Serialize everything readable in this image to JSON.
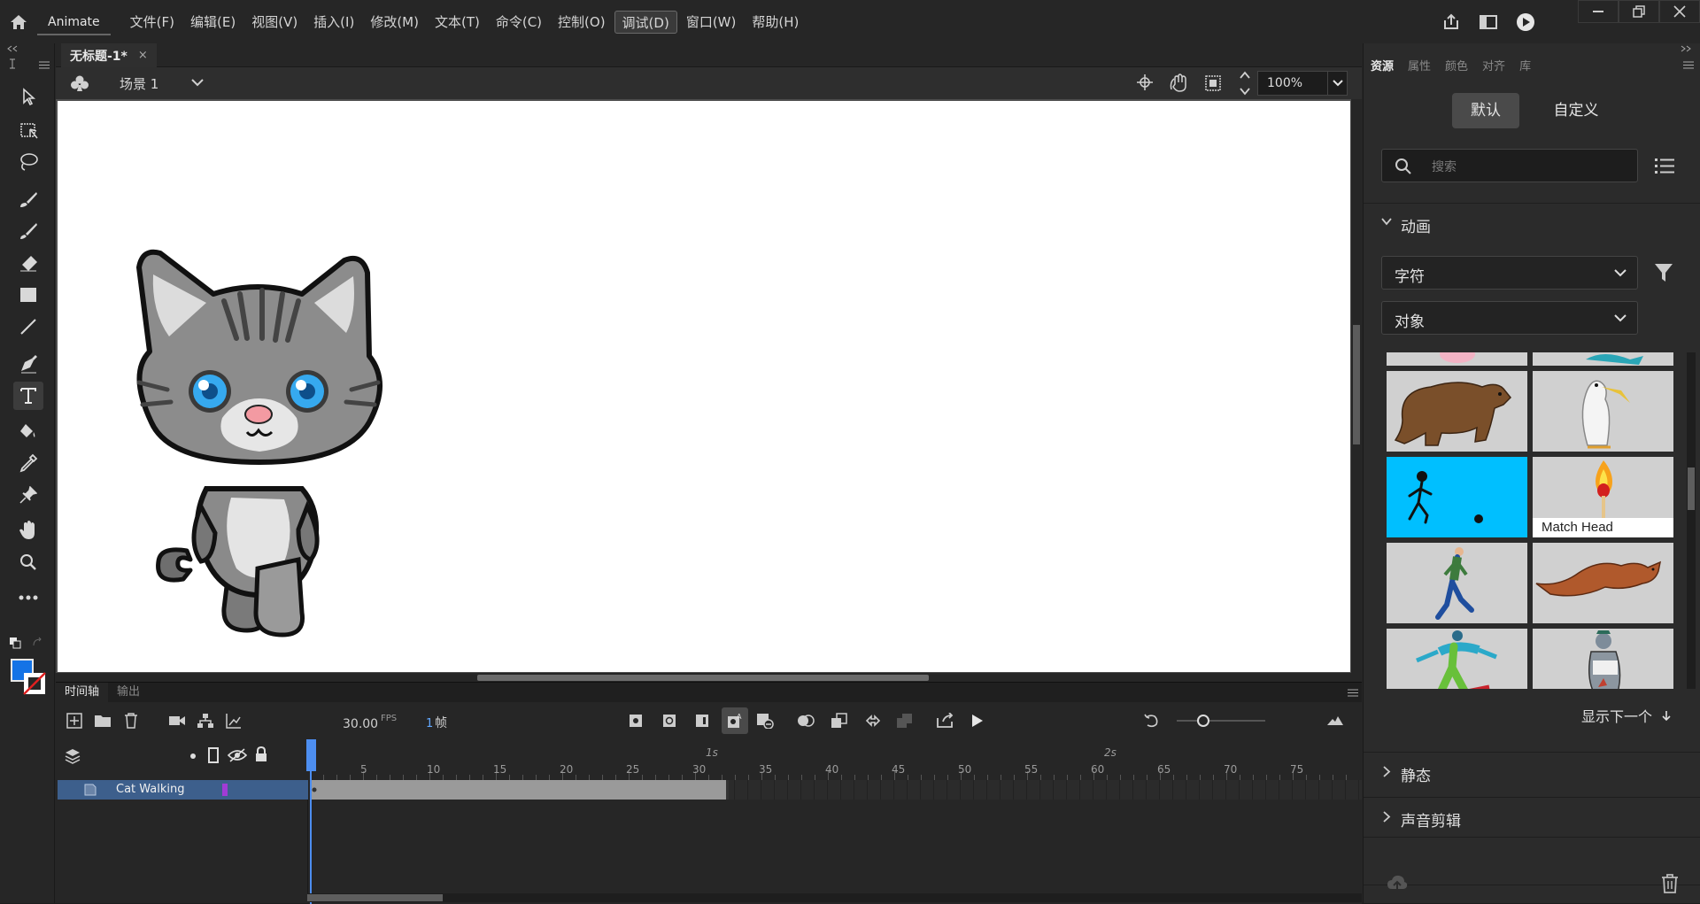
{
  "app": {
    "name": "Animate"
  },
  "menu": [
    "文件(F)",
    "编辑(E)",
    "视图(V)",
    "插入(I)",
    "修改(M)",
    "文本(T)",
    "命令(C)",
    "控制(O)",
    "调试(D)",
    "窗口(W)",
    "帮助(H)"
  ],
  "document": {
    "tab_title": "无标题-1*",
    "close_glyph": "×"
  },
  "stage": {
    "scene": "场景 1",
    "zoom": "100%"
  },
  "timeline": {
    "tabs": [
      "时间轴",
      "输出"
    ],
    "fps": "30.00",
    "fps_unit": "FPS",
    "current_frame": "1",
    "frame_unit": "帧",
    "layer_name": "Cat Walking",
    "ruler_numbers": [
      "5",
      "10",
      "15",
      "20",
      "25",
      "30",
      "35",
      "40",
      "45",
      "50",
      "55",
      "60",
      "65",
      "70",
      "75"
    ],
    "ruler_seconds": [
      "1s",
      "2s"
    ],
    "frame_span": 32
  },
  "assets": {
    "tabs": [
      "资源",
      "属性",
      "颜色",
      "对齐",
      "库"
    ],
    "segments": [
      "默认",
      "自定义"
    ],
    "search_placeholder": "搜索",
    "section_animation": "动画",
    "dropdown_1": "字符",
    "dropdown_2": "对象",
    "thumb_caption": "Match Head",
    "show_next": "显示下一个",
    "section_static": "静态",
    "section_sound": "声音剪辑"
  },
  "colors": {
    "accent": "#4d8ef0",
    "stroke_color": "#1473e6",
    "layer_highlight": "#3d5f8c",
    "layer_color": "#a23bd6"
  },
  "icons": [
    "home-icon",
    "share-icon",
    "workspace-icon",
    "play-icon",
    "minimize-icon",
    "restore-icon",
    "close-icon"
  ]
}
